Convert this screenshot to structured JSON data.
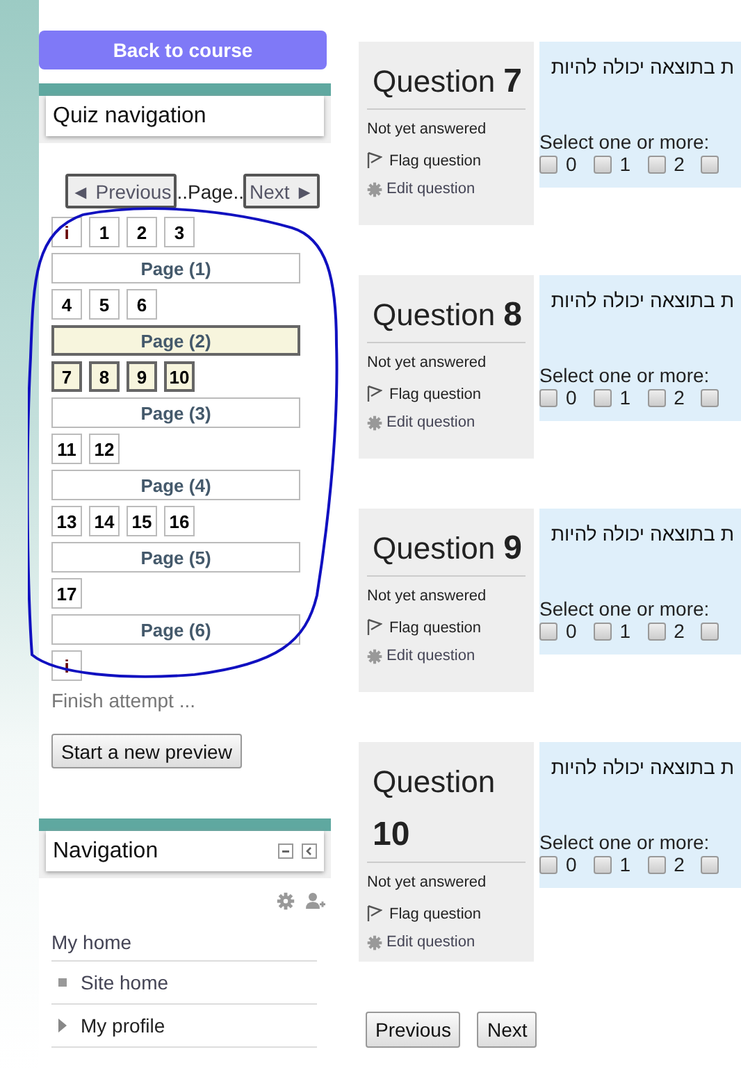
{
  "back_button": "Back to course",
  "quiz_navigation": {
    "title": "Quiz navigation",
    "previous": "◄ Previous",
    "page_label": "..Page..",
    "next": "Next ►",
    "sections": [
      {
        "buttons": [
          {
            "label": "i",
            "kind": "info",
            "selected": false
          },
          {
            "label": "1",
            "kind": "question",
            "selected": false
          },
          {
            "label": "2",
            "kind": "question",
            "selected": false
          },
          {
            "label": "3",
            "kind": "question",
            "selected": false
          }
        ],
        "page": {
          "label": "Page (1)",
          "selected": false
        }
      },
      {
        "buttons": [
          {
            "label": "4",
            "kind": "question",
            "selected": false
          },
          {
            "label": "5",
            "kind": "question",
            "selected": false
          },
          {
            "label": "6",
            "kind": "question",
            "selected": false
          }
        ],
        "page": {
          "label": "Page (2)",
          "selected": true
        }
      },
      {
        "buttons": [
          {
            "label": "7",
            "kind": "question",
            "selected": true
          },
          {
            "label": "8",
            "kind": "question",
            "selected": true
          },
          {
            "label": "9",
            "kind": "question",
            "selected": true
          },
          {
            "label": "10",
            "kind": "question",
            "selected": true
          }
        ],
        "page": {
          "label": "Page (3)",
          "selected": false
        }
      },
      {
        "buttons": [
          {
            "label": "11",
            "kind": "question",
            "selected": false
          },
          {
            "label": "12",
            "kind": "question",
            "selected": false
          }
        ],
        "page": {
          "label": "Page (4)",
          "selected": false
        }
      },
      {
        "buttons": [
          {
            "label": "13",
            "kind": "question",
            "selected": false
          },
          {
            "label": "14",
            "kind": "question",
            "selected": false
          },
          {
            "label": "15",
            "kind": "question",
            "selected": false
          },
          {
            "label": "16",
            "kind": "question",
            "selected": false
          }
        ],
        "page": {
          "label": "Page (5)",
          "selected": false
        }
      },
      {
        "buttons": [
          {
            "label": "17",
            "kind": "question",
            "selected": false
          }
        ],
        "page": {
          "label": "Page (6)",
          "selected": false
        }
      },
      {
        "buttons": [
          {
            "label": "i",
            "kind": "info",
            "selected": false
          }
        ]
      }
    ],
    "finish": "Finish attempt ...",
    "new_preview": "Start a new preview"
  },
  "navigation": {
    "title": "Navigation",
    "items": [
      {
        "label": "My home",
        "kind": "plain"
      },
      {
        "label": "Site home",
        "kind": "leaf"
      },
      {
        "label": "My profile",
        "kind": "branch"
      }
    ]
  },
  "questions": [
    {
      "title": "Question **7**",
      "status": "Not yet answered",
      "flag": "Flag question",
      "edit": "Edit question",
      "text": "ת בתוצאה יכולה להיות",
      "prompt": "Select one or more:",
      "options": [
        {
          "label": "0",
          "checked": false
        },
        {
          "label": "1",
          "checked": false
        },
        {
          "label": "2",
          "checked": false
        },
        {
          "checked": false
        }
      ]
    },
    {
      "title": "Question **8**",
      "status": "Not yet answered",
      "flag": "Flag question",
      "edit": "Edit question",
      "text": "ת בתוצאה יכולה להיות",
      "prompt": "Select one or more:",
      "options": [
        {
          "label": "0",
          "checked": false
        },
        {
          "label": "1",
          "checked": false
        },
        {
          "label": "2",
          "checked": false
        },
        {
          "checked": false
        }
      ]
    },
    {
      "title": "Question **9**",
      "status": "Not yet answered",
      "flag": "Flag question",
      "edit": "Edit question",
      "text": "ת בתוצאה יכולה להיות",
      "prompt": "Select one or more:",
      "options": [
        {
          "label": "0",
          "checked": false
        },
        {
          "label": "1",
          "checked": false
        },
        {
          "label": "2",
          "checked": false
        },
        {
          "checked": false
        }
      ]
    },
    {
      "title": "Question **10**",
      "status": "Not yet answered",
      "flag": "Flag question",
      "edit": "Edit question",
      "text": "ת בתוצאה יכולה להיות",
      "prompt": "Select one or more:",
      "options": [
        {
          "label": "0",
          "checked": false
        },
        {
          "label": "1",
          "checked": false
        },
        {
          "label": "2",
          "checked": false
        },
        {
          "checked": false
        }
      ]
    }
  ],
  "pager": {
    "previous": "Previous",
    "next": "Next"
  }
}
